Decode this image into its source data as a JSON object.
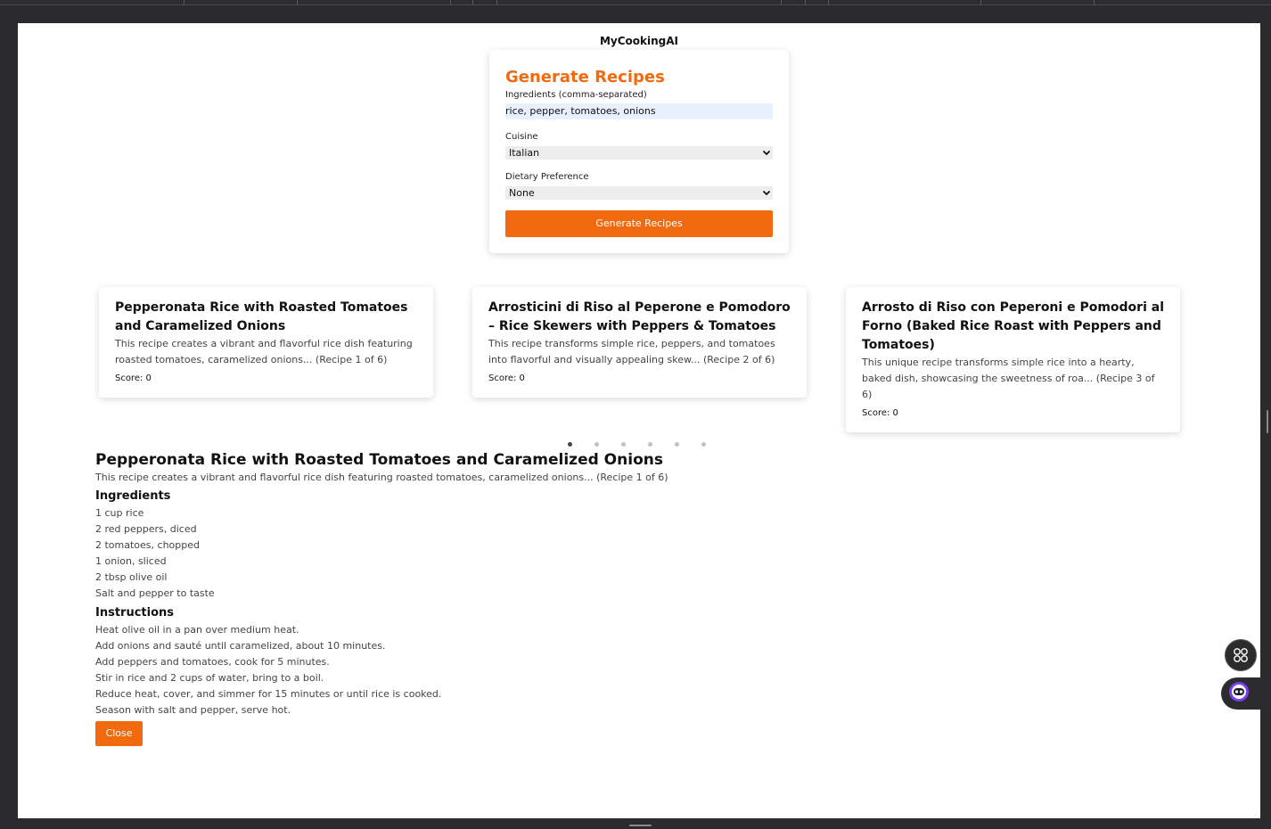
{
  "app": {
    "brand": "MyCookingAI"
  },
  "form": {
    "title": "Generate Recipes",
    "ingredients_label": "Ingredients (comma-separated)",
    "ingredients_value": "rice, pepper, tomatoes, onions",
    "cuisine_label": "Cuisine",
    "cuisine_value": "Italian",
    "dietary_label": "Dietary Preference",
    "dietary_value": "None",
    "submit_label": "Generate Recipes"
  },
  "recipes": [
    {
      "title": "Pepperonata Rice with Roasted Tomatoes and Caramelized Onions",
      "desc": "This recipe creates a vibrant and flavorful rice dish featuring roasted tomatoes, caramelized onions... (Recipe 1 of 6)",
      "score": "Score: 0"
    },
    {
      "title": "Arrosticini di Riso al Peperone e Pomodoro – Rice Skewers with Peppers & Tomatoes",
      "desc": "This recipe transforms simple rice, peppers, and tomatoes into flavorful and visually appealing skew... (Recipe 2 of 6)",
      "score": "Score: 0"
    },
    {
      "title": "Arrosto di Riso con Peperoni e Pomodori al Forno (Baked Rice Roast with Peppers and Tomatoes)",
      "desc": "This unique recipe transforms simple rice into a hearty, baked dish, showcasing the sweetness of roa... (Recipe 3 of 6)",
      "score": "Score: 0"
    }
  ],
  "carousel": {
    "total_pages": 6,
    "active_page": 1
  },
  "detail": {
    "title": "Pepperonata Rice with Roasted Tomatoes and Caramelized Onions",
    "desc": "This recipe creates a vibrant and flavorful rice dish featuring roasted tomatoes, caramelized onions... (Recipe 1 of 6)",
    "ingredients_heading": "Ingredients",
    "ingredients": [
      "1 cup rice",
      "2 red peppers, diced",
      "2 tomatoes, chopped",
      "1 onion, sliced",
      "2 tbsp olive oil",
      "Salt and pepper to taste"
    ],
    "instructions_heading": "Instructions",
    "instructions": [
      "Heat olive oil in a pan over medium heat.",
      "Add onions and sauté until caramelized, about 10 minutes.",
      "Add peppers and tomatoes, cook for 5 minutes.",
      "Stir in rice and 2 cups of water, bring to a boil.",
      "Reduce heat, cover, and simmer for 15 minutes or until rice is cooked.",
      "Season with salt and pepper, serve hot."
    ],
    "close_label": "Close"
  },
  "colors": {
    "accent": "#f26a0f",
    "bot_accent": "#7b3ff2"
  },
  "icons": {
    "select_chevron": "chevron-down-icon",
    "fab_apps": "apps-grid-icon",
    "fab_assistant": "assistant-bot-icon"
  }
}
